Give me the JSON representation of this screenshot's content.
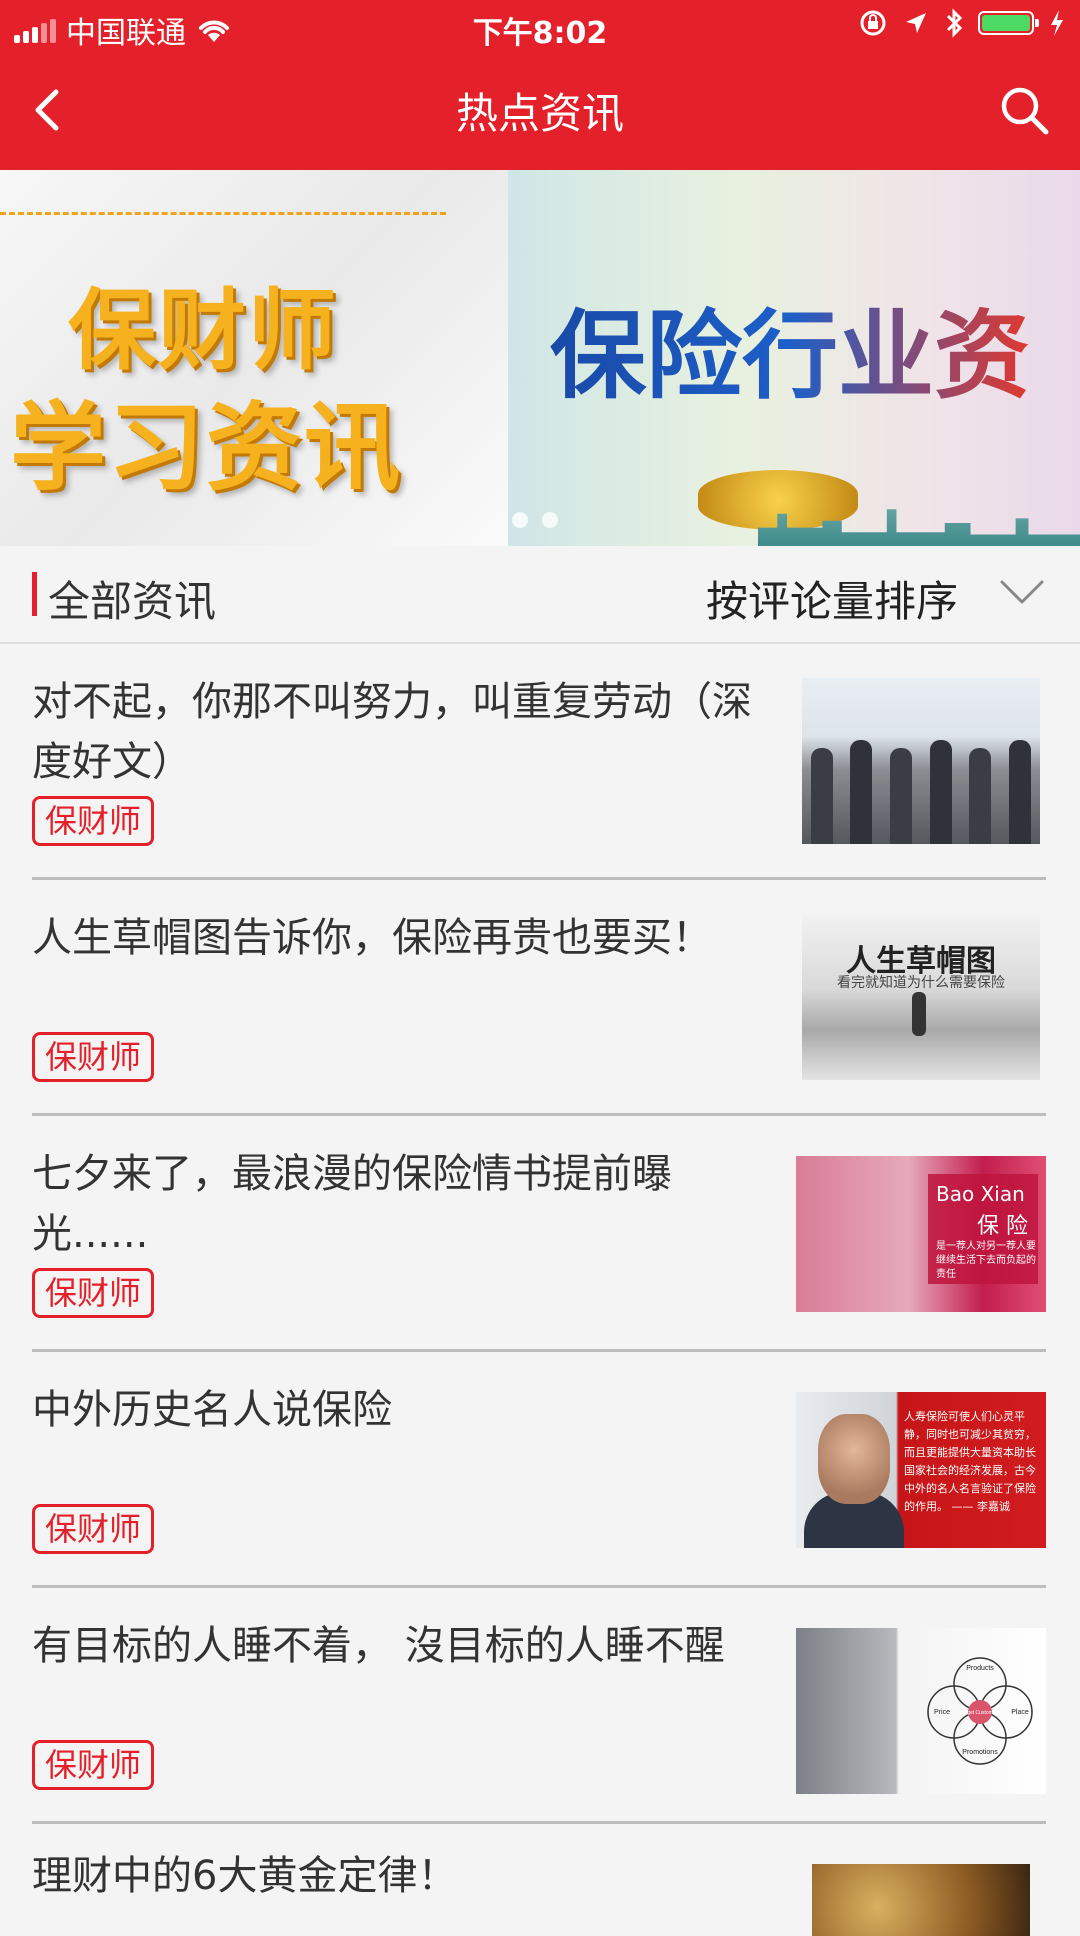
{
  "status_bar": {
    "carrier": "中国联通",
    "time": "下午8:02"
  },
  "nav": {
    "title": "热点资讯"
  },
  "banner": {
    "left_line1": "保财师",
    "left_line2": "学习资讯",
    "right_title": "保险行业资"
  },
  "filter": {
    "label": "全部资讯",
    "sort": "按评论量排序"
  },
  "articles": [
    {
      "title": "对不起，你那不叫努力，叫重复劳动（深度好文）",
      "tag": "保财师"
    },
    {
      "title": "人生草帽图告诉你，保险再贵也要买！",
      "tag": "保财师",
      "thumb_caption": "人生草帽图",
      "thumb_sub": "看完就知道为什么需要保险"
    },
    {
      "title": "七夕来了，最浪漫的保险情书提前曝光......",
      "tag": "保财师",
      "thumb_en": "Bao Xian",
      "thumb_cn": "保 险",
      "thumb_small": "是一荐人对另一荐人要继续生活下去而负起的责任"
    },
    {
      "title": "中外历史名人说保险",
      "tag": "保财师",
      "thumb_text": "人寿保险可使人们心灵平静，同时也可减少其贫穷，而且更能提供大量资本助长国家社会的经济发展，古今中外的名人名言验证了保险的作用。 —— 李嘉诚"
    },
    {
      "title": "有目标的人睡不着， 沒目标的人睡不醒",
      "tag": "保财师",
      "thumb_labels": [
        "Products",
        "Price",
        "Target Customers",
        "Place",
        "Promotions"
      ]
    },
    {
      "title": "理财中的6大黄金定律！"
    }
  ]
}
